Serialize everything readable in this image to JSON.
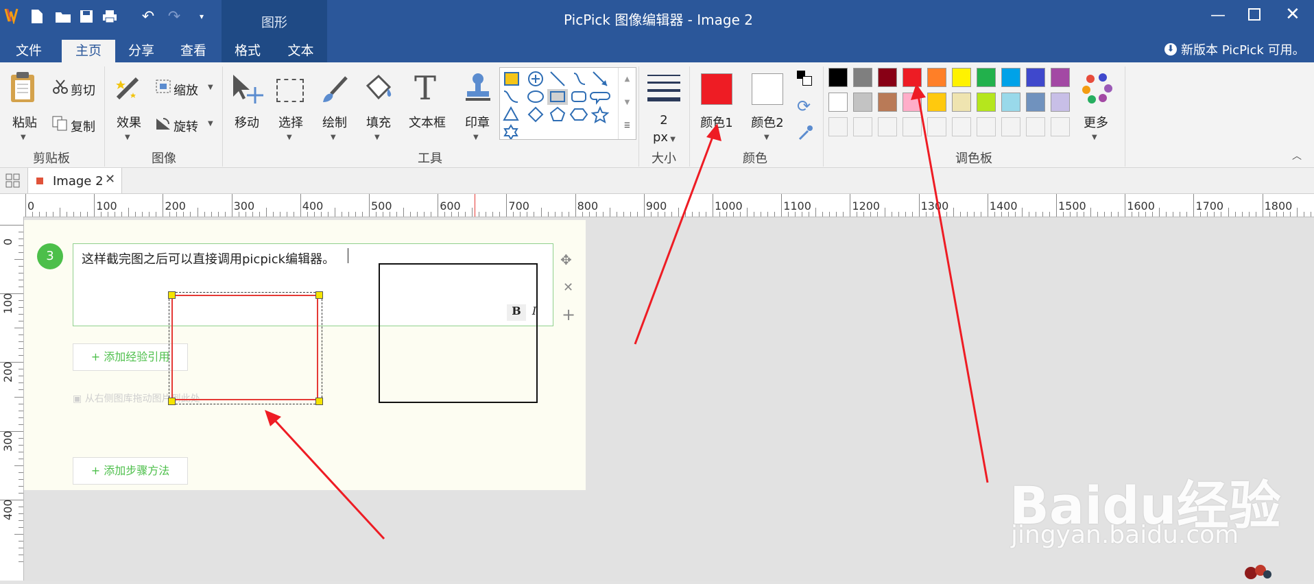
{
  "window": {
    "title": "PicPick 图像编辑器 - Image 2",
    "context_tab_header": "图形",
    "update_notice": "新版本 PicPick 可用。"
  },
  "tabs": [
    "文件",
    "主页",
    "分享",
    "查看",
    "格式",
    "文本"
  ],
  "ribbon": {
    "clipboard": {
      "paste": "粘贴",
      "cut": "剪切",
      "copy": "复制",
      "group": "剪贴板"
    },
    "image": {
      "effects": "效果",
      "resize": "缩放",
      "rotate": "旋转",
      "group": "图像"
    },
    "tools": {
      "move": "移动",
      "select": "选择",
      "draw": "绘制",
      "fill": "填充",
      "textbox": "文本框",
      "stamp": "印章",
      "group": "工具"
    },
    "size": {
      "value": "2",
      "unit": "px",
      "group": "大小"
    },
    "color": {
      "color1": "颜色1",
      "color2": "颜色2",
      "group": "颜色",
      "color1_value": "#ee1c24",
      "color2_value": "#ffffff"
    },
    "palette": {
      "more": "更多",
      "group": "调色板"
    }
  },
  "palette_colors": [
    [
      "#000000",
      "#7f7f7f",
      "#880015",
      "#ed1c24",
      "#ff7f27",
      "#fff200",
      "#22b14c",
      "#00a2e8",
      "#3f48cc",
      "#a349a4"
    ],
    [
      "#ffffff",
      "#c3c3c3",
      "#b97a57",
      "#ffaec9",
      "#ffc90e",
      "#efe4b0",
      "#b5e61d",
      "#99d9ea",
      "#7092be",
      "#c8bfe7"
    ]
  ],
  "document_tab": {
    "label": "Image 2"
  },
  "ruler": {
    "h": [
      "0",
      "100",
      "200",
      "300",
      "400",
      "500",
      "600",
      "700",
      "800",
      "900",
      "1000",
      "1100",
      "1200",
      "1300",
      "1400",
      "1500",
      "1600",
      "1700",
      "1800"
    ],
    "v": [
      "0",
      "100",
      "200",
      "300",
      "400"
    ]
  },
  "content": {
    "step_number": "3",
    "step_text": "这样截完图之后可以直接调用picpick编辑器。",
    "add_reference": "+ 添加经验引用",
    "drag_hint": "从右侧图库拖动图片到此处",
    "add_step": "+ 添加步骤方法",
    "bold": "B",
    "italic": "I"
  },
  "watermark": {
    "brand": "Baidu经验",
    "url": "jingyan.baidu.com"
  }
}
